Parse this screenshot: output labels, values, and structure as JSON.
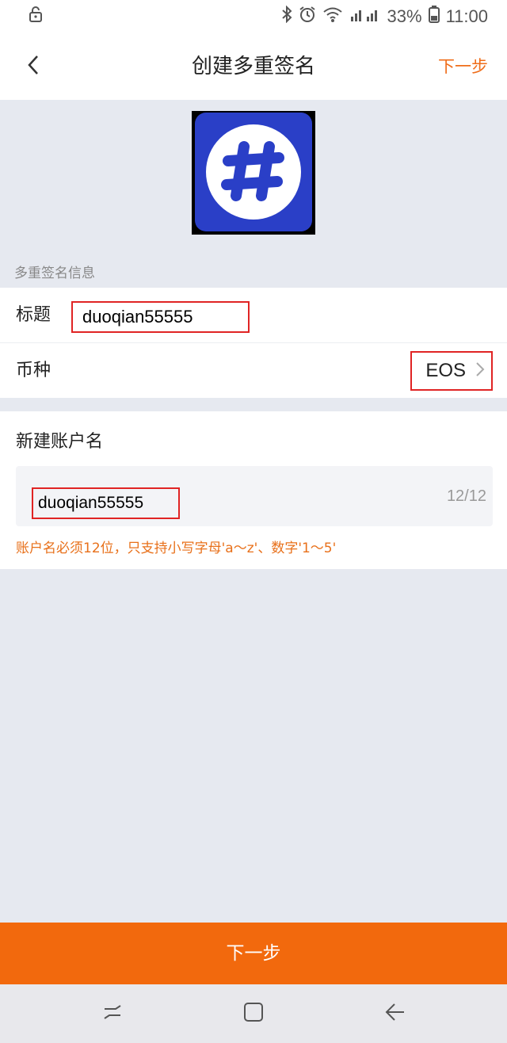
{
  "status_bar": {
    "battery": "33%",
    "time": "11:00",
    "icons": [
      "lock-icon",
      "bluetooth-icon",
      "alarm-icon",
      "wifi-icon",
      "signal-icon",
      "battery-icon"
    ]
  },
  "nav": {
    "title": "创建多重签名",
    "next_label": "下一步"
  },
  "section": {
    "info_label": "多重签名信息"
  },
  "form": {
    "title_label": "标题",
    "title_value": "duoqian55555",
    "coin_label": "币种",
    "coin_value": "EOS"
  },
  "account": {
    "label": "新建账户名",
    "value": "duoqian55555",
    "counter": "12/12",
    "hint": "账户名必须12位，只支持小写字母'a～z'、数字'1～5'"
  },
  "bottom_button": {
    "label": "下一步"
  },
  "colors": {
    "accent": "#f2690d",
    "highlight_border": "#e02424",
    "background": "#e6e9f0",
    "logo_blue": "#2a3fc7"
  }
}
